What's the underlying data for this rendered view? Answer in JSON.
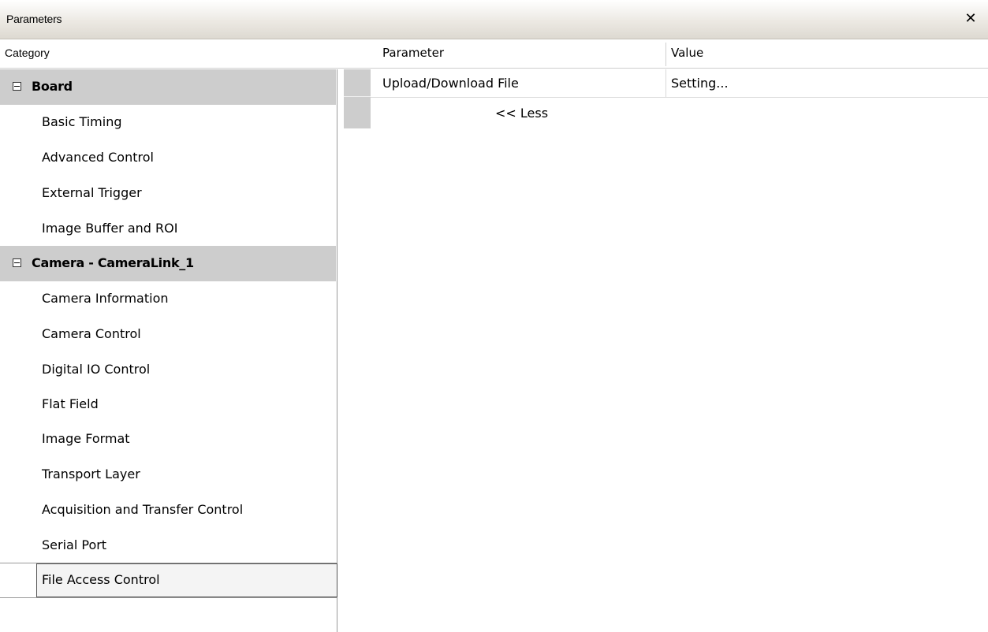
{
  "window": {
    "title": "Parameters",
    "close_glyph": "✕"
  },
  "header": {
    "category": "Category",
    "parameter": "Parameter",
    "value": "Value"
  },
  "tree": {
    "groups": [
      {
        "label": "Board",
        "items": [
          "Basic Timing",
          "Advanced Control",
          "External Trigger",
          "Image Buffer and ROI"
        ]
      },
      {
        "label": "Camera - CameraLink_1",
        "items": [
          "Camera Information",
          "Camera Control",
          "Digital IO Control",
          "Flat Field",
          "Image Format",
          "Transport Layer",
          "Acquisition and Transfer Control",
          "Serial Port"
        ]
      }
    ],
    "selected_item": "File Access Control"
  },
  "grid": {
    "rows": [
      {
        "parameter": "Upload/Download File",
        "value": "Setting..."
      }
    ],
    "less_link": "<< Less"
  },
  "icons": {
    "expander": "collapse-icon",
    "close": "close-icon"
  }
}
